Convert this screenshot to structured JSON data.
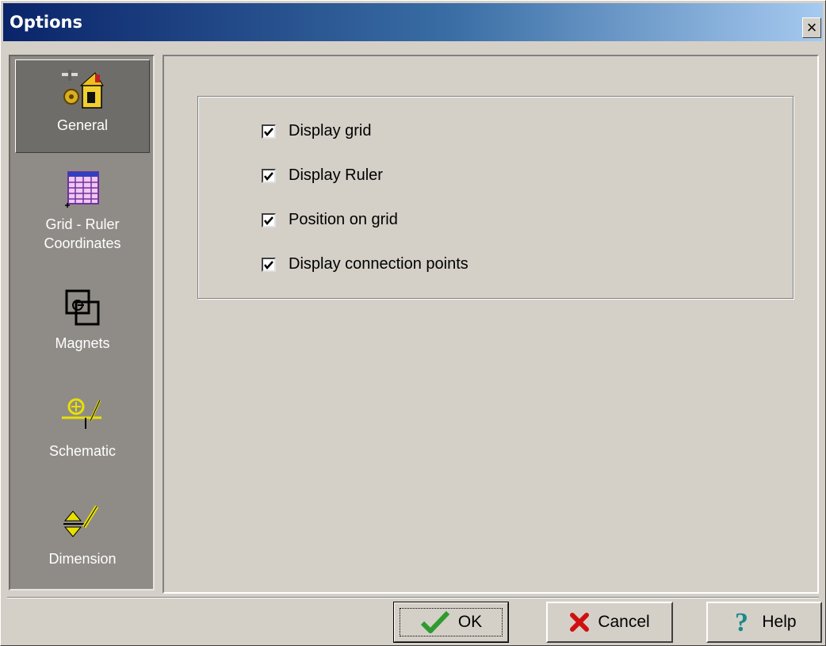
{
  "window": {
    "title": "Options",
    "close_label": "×"
  },
  "sidebar": {
    "items": [
      {
        "label": "General",
        "icon": "general-settings-icon",
        "selected": true
      },
      {
        "label": "Grid - Ruler Coordinates",
        "icon": "grid-icon",
        "selected": false
      },
      {
        "label": "Magnets",
        "icon": "magnet-icon",
        "selected": false
      },
      {
        "label": "Schematic",
        "icon": "schematic-icon",
        "selected": false
      },
      {
        "label": "Dimension",
        "icon": "dimension-icon",
        "selected": false
      }
    ]
  },
  "general": {
    "checkboxes": [
      {
        "label": "Display grid",
        "checked": true
      },
      {
        "label": "Display Ruler",
        "checked": true
      },
      {
        "label": "Position on grid",
        "checked": true
      },
      {
        "label": "Display connection points",
        "checked": true
      }
    ]
  },
  "buttons": {
    "ok": {
      "label": "OK",
      "icon": "checkmark-icon"
    },
    "cancel": {
      "label": "Cancel",
      "icon": "red-x-icon"
    },
    "help": {
      "label": "Help",
      "icon": "question-mark-icon"
    }
  },
  "colors": {
    "titlebar_start": "#0a246a",
    "titlebar_end": "#a6caf0",
    "face": "#d4d0c8",
    "sidebar": "#8f8c87",
    "ok_check": "#2e9b2e",
    "cancel_x": "#d01010",
    "help_q": "#1a8a8a"
  }
}
